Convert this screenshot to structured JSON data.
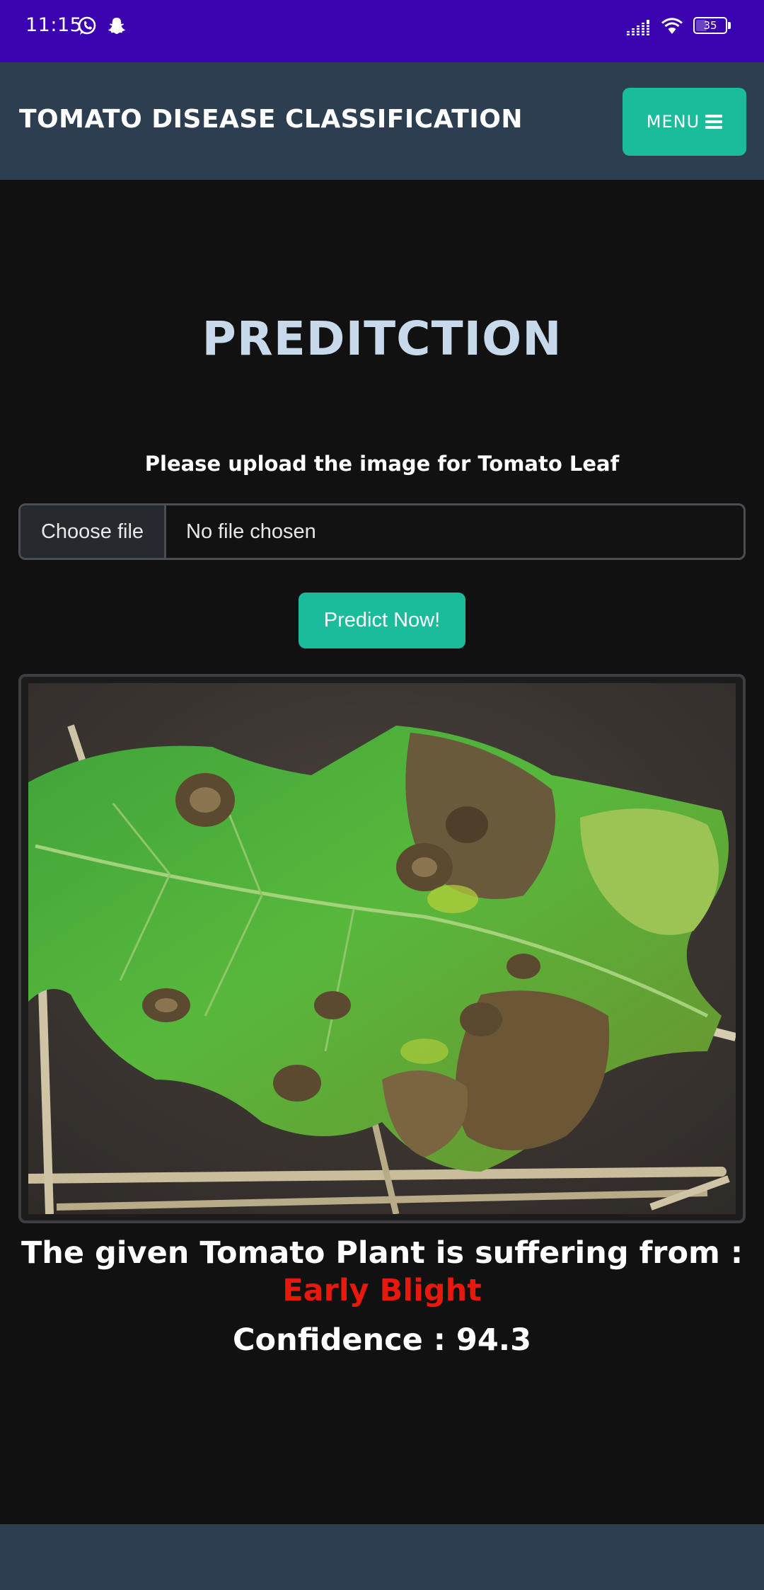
{
  "status_bar": {
    "time": "11:15",
    "battery_level": "35",
    "icons": [
      "whatsapp-icon",
      "snapchat-icon",
      "signal-icon",
      "wifi-icon",
      "battery-icon"
    ]
  },
  "navbar": {
    "brand": "TOMATO DISEASE CLASSIFICATION",
    "menu_label": "MENU"
  },
  "main": {
    "heading": "PREDITCTION",
    "upload_label": "Please upload the image for Tomato Leaf",
    "file_input": {
      "button_label": "Choose file",
      "status": "No file chosen"
    },
    "predict_label": "Predict Now!",
    "result_prefix": "The given Tomato Plant is suffering from :",
    "disease": "Early Blight",
    "confidence": "Confidence : 94.3"
  },
  "colors": {
    "status_bar": "#3a04b0",
    "navbar": "#2c3e50",
    "accent": "#1abc9c",
    "heading": "#c8d9ec",
    "disease": "#e8180c",
    "background": "#111111"
  }
}
